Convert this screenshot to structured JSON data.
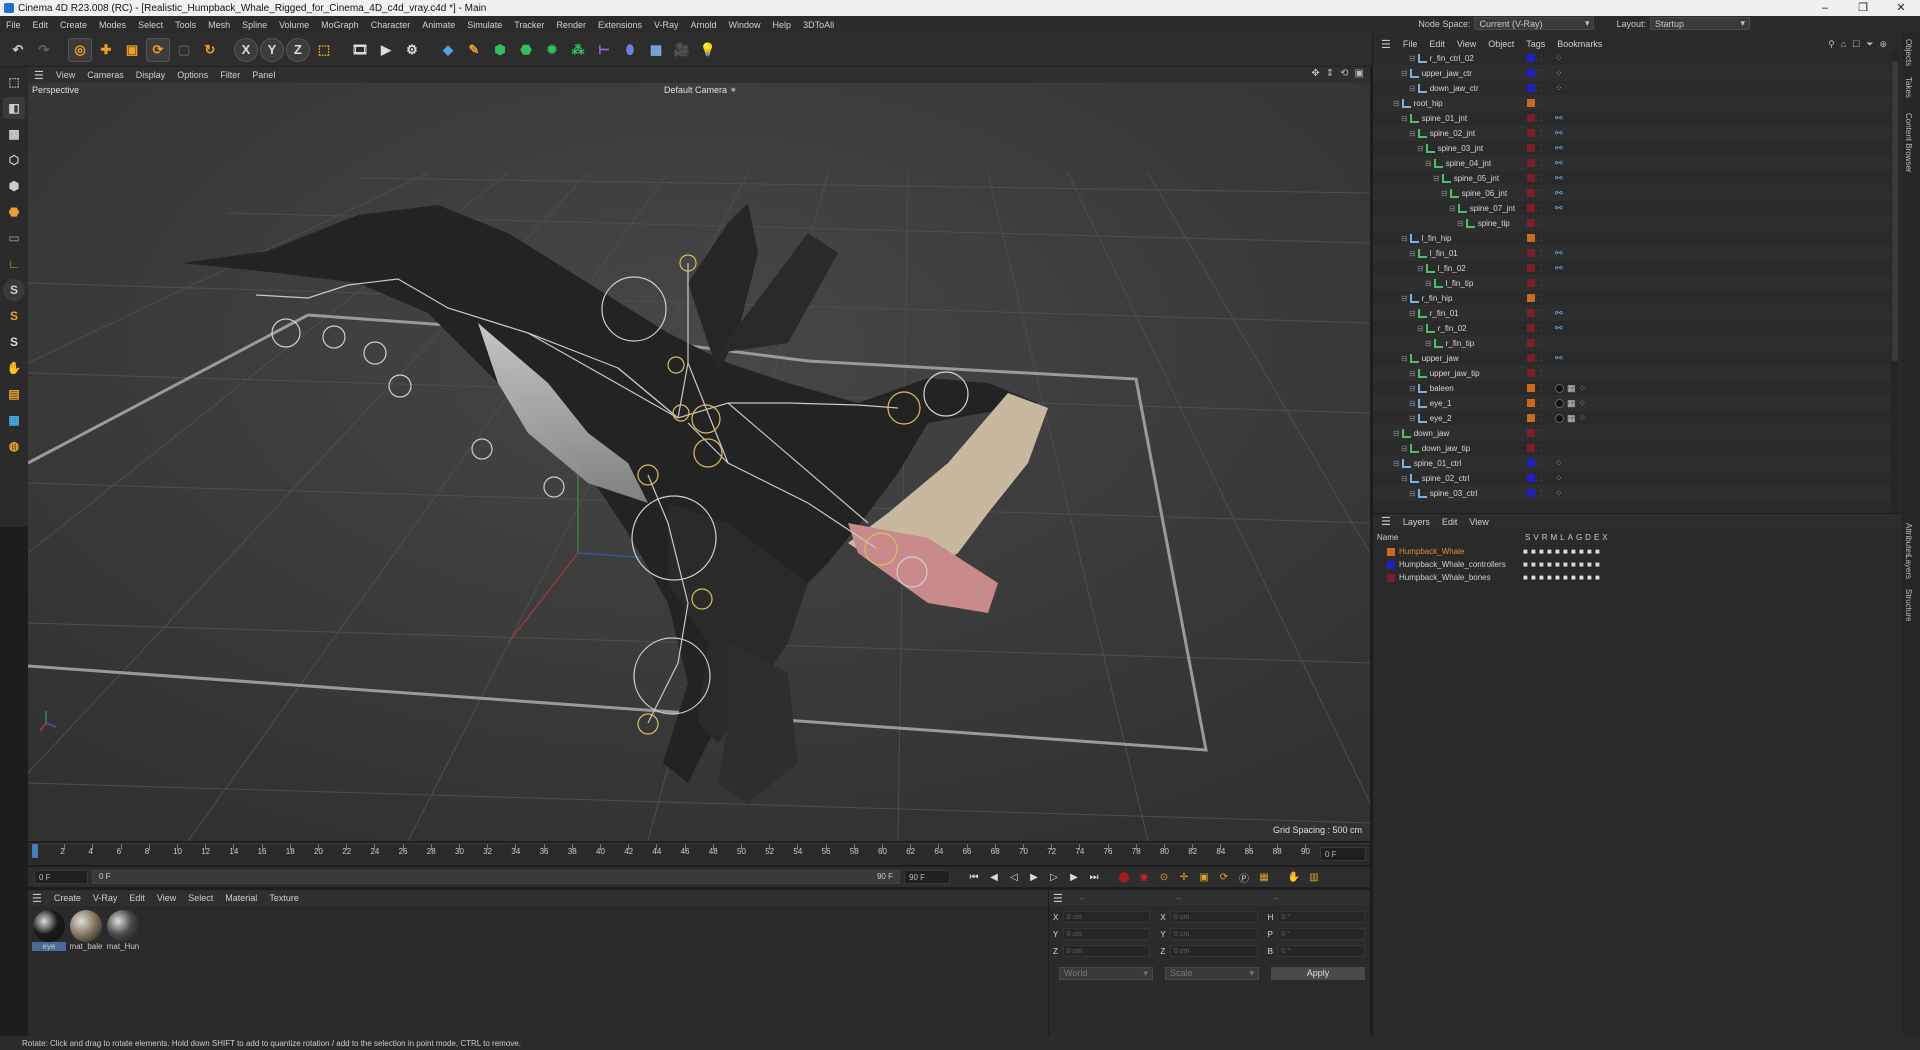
{
  "window": {
    "title": "Cinema 4D R23.008 (RC) - [Realistic_Humpback_Whale_Rigged_for_Cinema_4D_c4d_vray.c4d *] - Main"
  },
  "menubar": {
    "items": [
      "File",
      "Edit",
      "Create",
      "Modes",
      "Select",
      "Tools",
      "Mesh",
      "Spline",
      "Volume",
      "MoGraph",
      "Character",
      "Animate",
      "Simulate",
      "Tracker",
      "Render",
      "Extensions",
      "V-Ray",
      "Arnold",
      "Window",
      "Help",
      "3DToAll"
    ],
    "node_space_label": "Node Space:",
    "node_space_value": "Current (V-Ray)",
    "layout_label": "Layout:",
    "layout_value": "Startup"
  },
  "viewport": {
    "menu": [
      "View",
      "Cameras",
      "Display",
      "Options",
      "Filter",
      "Panel"
    ],
    "label": "Perspective",
    "camera": "Default Camera",
    "grid_spacing": "Grid Spacing : 500 cm"
  },
  "timeline": {
    "ticks": [
      "0",
      "2",
      "4",
      "6",
      "8",
      "10",
      "12",
      "14",
      "16",
      "18",
      "20",
      "22",
      "24",
      "26",
      "28",
      "30",
      "32",
      "34",
      "36",
      "38",
      "40",
      "42",
      "44",
      "46",
      "48",
      "50",
      "52",
      "54",
      "56",
      "58",
      "60",
      "62",
      "64",
      "66",
      "68",
      "70",
      "72",
      "74",
      "76",
      "78",
      "80",
      "82",
      "84",
      "86",
      "88",
      "90"
    ],
    "current_frame": "0 F",
    "start_field": "0 F",
    "range_start": "0 F",
    "range_end": "90 F",
    "end_field": "90 F"
  },
  "materials": {
    "menu": [
      "Create",
      "V-Ray",
      "Edit",
      "View",
      "Select",
      "Material",
      "Texture"
    ],
    "items": [
      {
        "name": "eye",
        "color": "#1a1a1a"
      },
      {
        "name": "mat_bale",
        "color": "#8a7a62"
      },
      {
        "name": "mat_Hun",
        "color": "#4a4a4a"
      }
    ]
  },
  "coords": {
    "header": [
      "--",
      "--",
      "--"
    ],
    "rows": [
      {
        "a": "X",
        "av": "0 cm",
        "b": "X",
        "bv": "0 cm",
        "c": "H",
        "cv": "0 °"
      },
      {
        "a": "Y",
        "av": "0 cm",
        "b": "Y",
        "bv": "0 cm",
        "c": "P",
        "cv": "0 °"
      },
      {
        "a": "Z",
        "av": "0 cm",
        "b": "Z",
        "bv": "0 cm",
        "c": "B",
        "cv": "0 °"
      }
    ],
    "world": "World",
    "scale": "Scale",
    "apply": "Apply"
  },
  "objects": {
    "menu": [
      "File",
      "Edit",
      "View",
      "Object",
      "Tags",
      "Bookmarks"
    ],
    "rows": [
      {
        "name": "r_fin_ctrl_02",
        "indent": 3,
        "color": "#2020c8",
        "tags": "ctrl"
      },
      {
        "name": "upper_jaw_ctr",
        "indent": 2,
        "color": "#2020c8",
        "tags": "ctrl"
      },
      {
        "name": "down_jaw_ctr",
        "indent": 3,
        "color": "#2020c8",
        "tags": "ctrl"
      },
      {
        "name": "root_hip",
        "indent": 1,
        "color": "#c86a20",
        "tags": "none"
      },
      {
        "name": "spine_01_jnt",
        "indent": 2,
        "color": "#7a1e2a",
        "tags": "ik"
      },
      {
        "name": "spine_02_jnt",
        "indent": 3,
        "color": "#7a1e2a",
        "tags": "ik"
      },
      {
        "name": "spine_03_jnt",
        "indent": 4,
        "color": "#7a1e2a",
        "tags": "ik"
      },
      {
        "name": "spine_04_jnt",
        "indent": 5,
        "color": "#7a1e2a",
        "tags": "ik"
      },
      {
        "name": "spine_05_jnt",
        "indent": 6,
        "color": "#7a1e2a",
        "tags": "ik"
      },
      {
        "name": "spine_06_jnt",
        "indent": 7,
        "color": "#7a1e2a",
        "tags": "ik"
      },
      {
        "name": "spine_07_jnt",
        "indent": 8,
        "color": "#7a1e2a",
        "tags": "ik"
      },
      {
        "name": "spine_tip",
        "indent": 9,
        "color": "#7a1e2a",
        "tags": "none"
      },
      {
        "name": "l_fin_hip",
        "indent": 2,
        "color": "#c86a20",
        "tags": "none"
      },
      {
        "name": "l_fin_01",
        "indent": 3,
        "color": "#7a1e2a",
        "tags": "ik"
      },
      {
        "name": "l_fin_02",
        "indent": 4,
        "color": "#7a1e2a",
        "tags": "ik"
      },
      {
        "name": "l_fin_tip",
        "indent": 5,
        "color": "#7a1e2a",
        "tags": "none"
      },
      {
        "name": "r_fin_hip",
        "indent": 2,
        "color": "#c86a20",
        "tags": "none"
      },
      {
        "name": "r_fin_01",
        "indent": 3,
        "color": "#7a1e2a",
        "tags": "ik"
      },
      {
        "name": "r_fin_02",
        "indent": 4,
        "color": "#7a1e2a",
        "tags": "ik"
      },
      {
        "name": "r_fin_tip",
        "indent": 5,
        "color": "#7a1e2a",
        "tags": "none"
      },
      {
        "name": "upper_jaw",
        "indent": 2,
        "color": "#7a1e2a",
        "tags": "ik"
      },
      {
        "name": "upper_jaw_tip",
        "indent": 3,
        "color": "#7a1e2a",
        "tags": "none"
      },
      {
        "name": "baleen",
        "indent": 3,
        "color": "#c86a20",
        "tags": "mat"
      },
      {
        "name": "eye_1",
        "indent": 3,
        "color": "#c86a20",
        "tags": "mat"
      },
      {
        "name": "eye_2",
        "indent": 3,
        "color": "#c86a20",
        "tags": "mat"
      },
      {
        "name": "down_jaw",
        "indent": 1,
        "color": "#7a1e2a",
        "tags": "none"
      },
      {
        "name": "down_jaw_tip",
        "indent": 2,
        "color": "#7a1e2a",
        "tags": "none"
      },
      {
        "name": "spine_01_ctrl",
        "indent": 1,
        "color": "#2020c8",
        "tags": "ctrl"
      },
      {
        "name": "spine_02_ctrl",
        "indent": 2,
        "color": "#2020c8",
        "tags": "ctrl"
      },
      {
        "name": "spine_03_ctrl",
        "indent": 3,
        "color": "#2020c8",
        "tags": "ctrl"
      }
    ]
  },
  "layers": {
    "menu": [
      "Layers",
      "Edit",
      "View"
    ],
    "header_name": "Name",
    "header_cols": [
      "S",
      "V",
      "R",
      "M",
      "L",
      "A",
      "G",
      "D",
      "E",
      "X"
    ],
    "rows": [
      {
        "name": "Humpback_Whale",
        "color": "#c86a20",
        "text_color": "#e08a30"
      },
      {
        "name": "Humpback_Whale_controllers",
        "color": "#2020c8",
        "text_color": "#d0d0d0"
      },
      {
        "name": "Humpback_Whale_bones",
        "color": "#7a1e2a",
        "text_color": "#d0d0d0"
      }
    ]
  },
  "side_tabs": [
    "Objects",
    "Takes",
    "Content Browser",
    "Attributes",
    "Layers",
    "Structure"
  ],
  "status": "Rotate: Click and drag to rotate elements. Hold down SHIFT to add to quantize rotation / add to the selection in point mode, CTRL to remove."
}
